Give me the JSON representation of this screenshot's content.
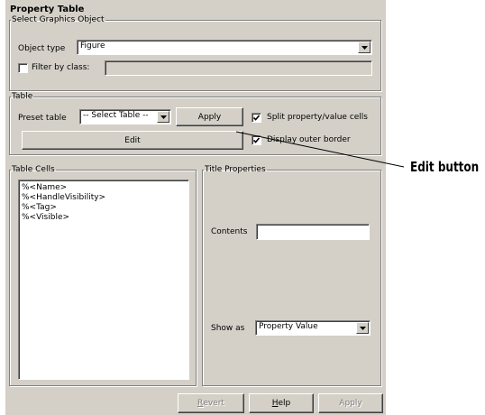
{
  "dialog_title": "Property Table",
  "select_group": {
    "legend": "Select Graphics Object",
    "object_type_label": "Object type",
    "object_type_value": "Figure",
    "filter_label": "Filter by class:",
    "filter_checked": false,
    "filter_value": ""
  },
  "table_group": {
    "legend": "Table",
    "preset_label": "Preset table",
    "preset_value": "-- Select Table --",
    "apply_label": "Apply",
    "edit_label": "Edit",
    "split_label": "Split property/value cells",
    "split_checked": true,
    "border_label": "Display outer border",
    "border_checked": true
  },
  "cells_group": {
    "legend": "Table Cells",
    "items": [
      "%<Name>",
      "%<HandleVisibility>",
      "%<Tag>",
      "%<Visible>"
    ]
  },
  "title_group": {
    "legend": "Title Properties",
    "contents_label": "Contents",
    "contents_value": "",
    "show_as_label": "Show as",
    "show_as_value": "Property Value"
  },
  "footer": {
    "revert_prefix": "",
    "revert_mnemonic": "R",
    "revert_rest": "evert",
    "help_mnemonic": "H",
    "help_rest": "elp",
    "apply_label": "Apply"
  },
  "callout": {
    "label": "Edit button"
  }
}
